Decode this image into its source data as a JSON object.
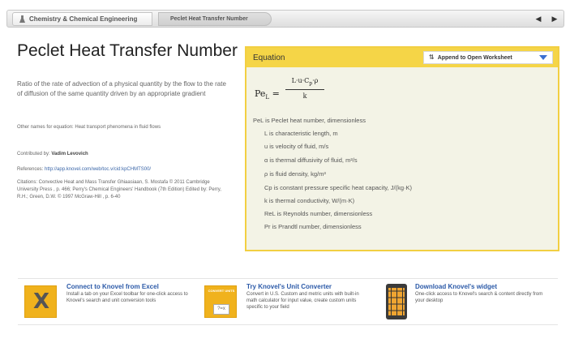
{
  "breadcrumb": {
    "items": [
      "Chemistry & Chemical Engineering",
      "Peclet Heat Transfer Number"
    ]
  },
  "nav": {
    "prev": "◀",
    "next": "▶"
  },
  "page": {
    "title": "Peclet Heat Transfer Number",
    "description": "Ratio of the rate of advection of a physical quantity by the flow to the rate of diffusion of the same quantity driven by an appropriate gradient",
    "other_names": "Other names for equation: Heat transport phenomena in fluid flows",
    "contributed_label": "Contributed by:",
    "contributed_by": "Vadim Levovich",
    "references_label": "References:",
    "references_url": "http://app.knovel.com/web/toc.v/cid:kpCHMTS00/",
    "citations": "Citations: Convective Heat and Mass Transfer Ghiaasiaan, S. Mostafa © 2011 Cambridge University Press , p. 466; Perry's Chemical Engineers' Handbook (7th Edition) Edited by: Perry, R.H.; Green, D.W. © 1997 McGraw-Hill , p. 6-40"
  },
  "equation": {
    "header": "Equation",
    "append_label": "Append to Open Worksheet",
    "lhs": "Pe",
    "lhs_sub": "L",
    "numerator": "L·u·C",
    "numerator_sub": "p",
    "numerator_tail": "·ρ",
    "denominator": "k",
    "variables": [
      "PeL is Peclet heat number, dimensionless",
      "L is characteristic length, m",
      "u is velocity of fluid, m/s",
      "α is thermal diffusivity of fluid, m²/s",
      "ρ is fluid density, kg/m³",
      "Cp is constant pressure specific heat capacity, J/(kg·K)",
      "k is thermal conductivity, W/(m·K)",
      "ReL is Reynolds number, dimensionless",
      "Pr is Prandtl number, dimensionless"
    ]
  },
  "promos": [
    {
      "title": "Connect to Knovel from Excel",
      "text": "Install a tab on your Excel toolbar for one-click access to Knovel's search and unit conversion tools",
      "icon": "excel-icon"
    },
    {
      "title": "Try Knovel's Unit Converter",
      "text": "Convert in U.S. Custom and metric units with built-in math calculator for input value, create custom units specific to your field",
      "icon": "unit-converter-icon",
      "icon_text": "CONVERT UNITS"
    },
    {
      "title": "Download Knovel's widget",
      "text": "One-click access to Knovel's search & content directly from your desktop",
      "icon": "widget-icon"
    }
  ],
  "colors": {
    "accent": "#f5d547",
    "link": "#2c5aa8",
    "panel_bg": "#f3f3e6"
  }
}
